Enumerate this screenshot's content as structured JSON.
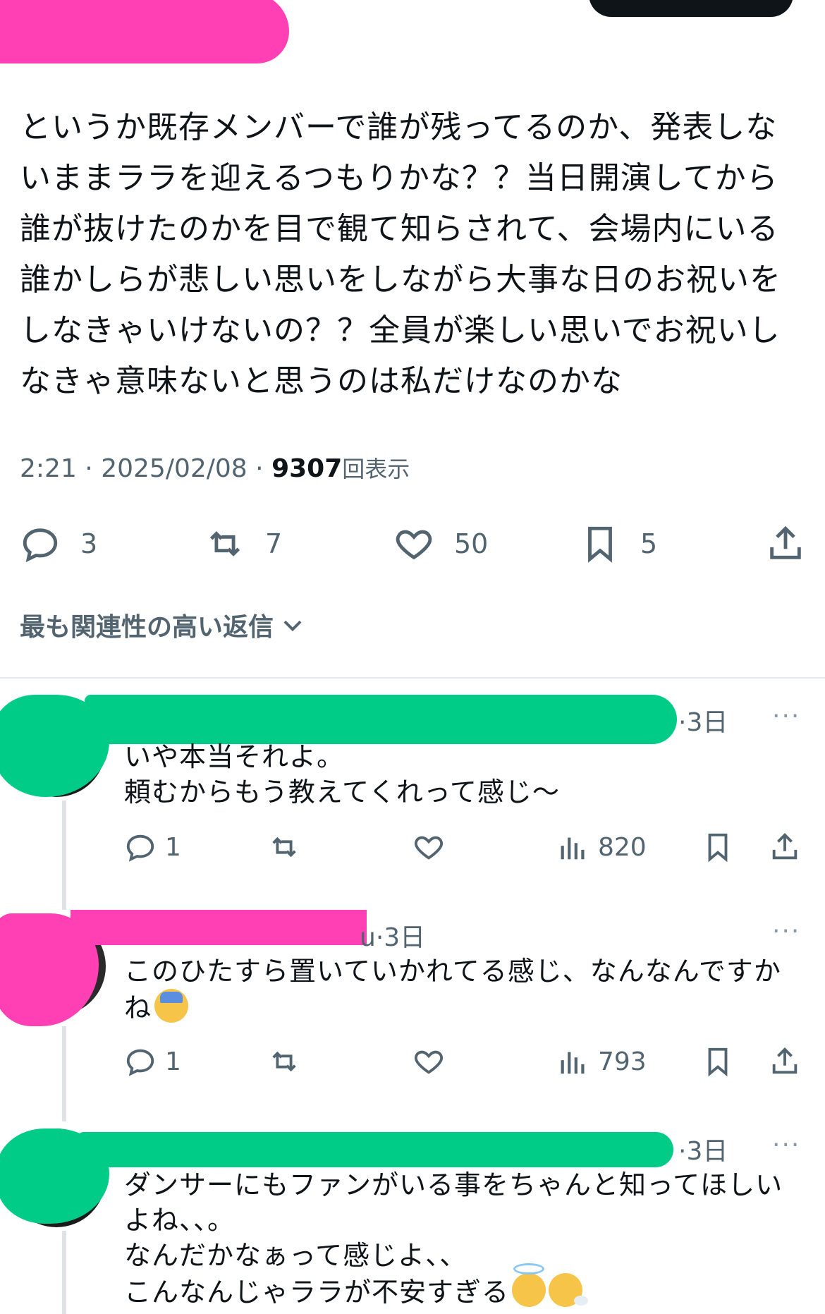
{
  "post": {
    "text": "というか既存メンバーで誰が残ってるのか、発表しないままララを迎えるつもりかな？？当日開演してから誰が抜けたのかを目で観て知らされて、会場内にいる誰かしらが悲しい思いをしながら大事な日のお祝いをしなきゃいけないの？？全員が楽しい思いでお祝いしなきゃ意味ないと思うのは私だけなのかな",
    "time": "2:21",
    "date": "2025/02/08",
    "views": "9307",
    "views_label": "回表示",
    "sep": "·"
  },
  "actions": {
    "replies": "3",
    "reposts": "7",
    "likes": "50",
    "bookmarks": "5"
  },
  "sort": {
    "label": "最も関連性の高い返信"
  },
  "replies": [
    {
      "handle_suffix": "",
      "time": "3日",
      "more": "···",
      "text": "いや本当それよ。\n頼むからもう教えてくれって感じ〜",
      "emojis": [],
      "replies": "1",
      "views": "820"
    },
    {
      "handle_suffix": "u",
      "time": "3日",
      "more": "···",
      "text": "このひたすら置いていかれてる感じ、なんなんですかね",
      "emojis": [
        "anxious-sweat"
      ],
      "replies": "1",
      "views": "793"
    },
    {
      "handle_suffix": "",
      "time": "3日",
      "more": "···",
      "text": "ダンサーにもファンがいる事をちゃんと知ってほしいよね、、。\nなんだかなぁって感じよ、、\nこんなんじゃララが不安すぎる",
      "emojis": [
        "smiling-halo",
        "face-exhaling"
      ]
    }
  ]
}
